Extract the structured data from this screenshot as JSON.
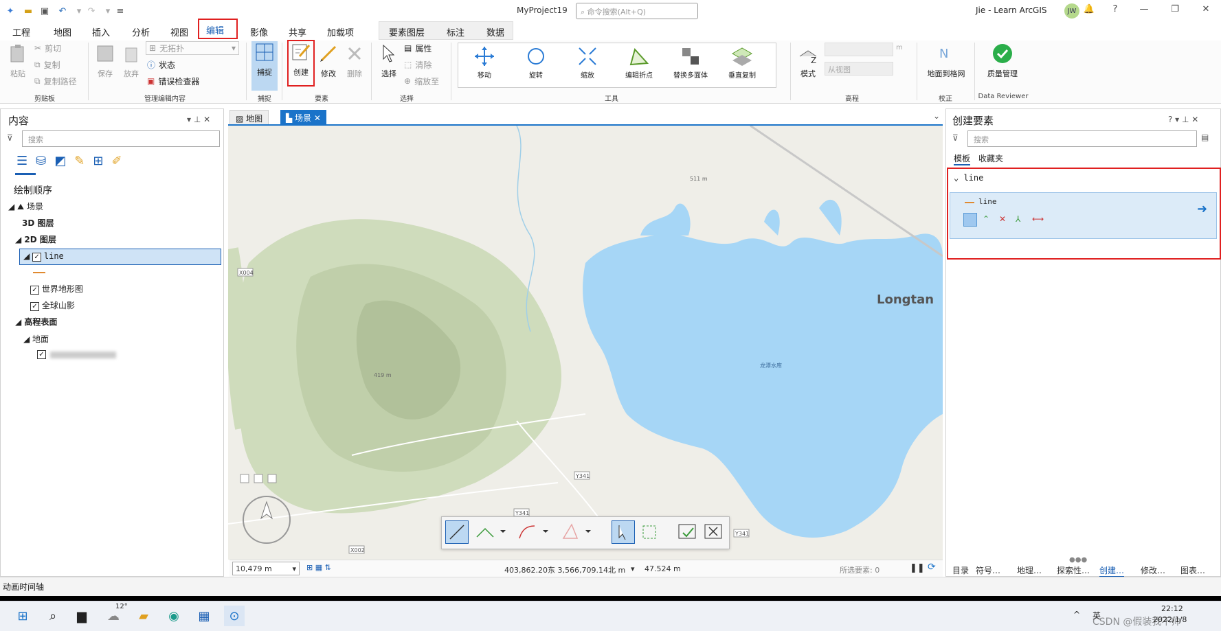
{
  "app": {
    "title": "MyProject19",
    "search_placeholder": "命令搜索(Alt+Q)",
    "user": "Jie - Learn ArcGIS",
    "avatar": "JW"
  },
  "tabs": [
    "工程",
    "地图",
    "插入",
    "分析",
    "视图",
    "编辑",
    "影像",
    "共享",
    "加载项"
  ],
  "context_tabs": [
    "要素图层",
    "标注",
    "数据"
  ],
  "ribbon": {
    "clipboard": {
      "paste": "粘贴",
      "cut": "剪切",
      "copy": "复制",
      "copy_path": "复制路径",
      "label": "剪贴板"
    },
    "manage": {
      "save": "保存",
      "discard": "放弃",
      "topology": "无拓扑",
      "status": "状态",
      "error_inspector": "错误检查器",
      "label": "管理编辑内容"
    },
    "snap": {
      "button": "捕捉",
      "label": "捕捉"
    },
    "features": {
      "create": "创建",
      "modify": "修改",
      "delete": "删除",
      "label": "要素"
    },
    "selection": {
      "select": "选择",
      "attributes": "属性",
      "clear": "清除",
      "zoom_to": "缩放至",
      "label": "选择"
    },
    "tools": {
      "items": [
        "移动",
        "旋转",
        "缩放",
        "编辑折点",
        "替换多面体",
        "垂直复制"
      ],
      "label": "工具"
    },
    "elevation": {
      "mode": "模式",
      "from_view": "从视图",
      "unit": "m",
      "label": "高程"
    },
    "correction": {
      "ground_to_grid": "地面到格网",
      "label": "校正"
    },
    "reviewer": {
      "quality": "质量管理",
      "label": "Data Reviewer"
    }
  },
  "contents": {
    "title": "内容",
    "search": "搜索",
    "draw_order": "绘制顺序",
    "scene": "场景",
    "layer3d": "3D 图层",
    "layer2d": "2D 图层",
    "line_layer": "line",
    "topo": "世界地形图",
    "hillshade": "全球山影",
    "elev_surface": "高程表面",
    "ground": "地面"
  },
  "map": {
    "tabs": [
      "地图",
      "场景"
    ],
    "labels": {
      "x004": "X004",
      "longtan": "Longtan",
      "reservoir": "龙潭水库",
      "y341a": "Y341",
      "y341b": "Y341",
      "y341c": "Y341",
      "x002": "X002",
      "peak1": "419 m",
      "peak2": "511 m"
    },
    "scale": "10,479 m",
    "coords": "403,862.20东 3,566,709.14北 m",
    "elev": "47.524 m",
    "selected": "所选要素: 0"
  },
  "create_features": {
    "title": "创建要素",
    "search": "搜索",
    "tab_templates": "模板",
    "tab_favorites": "收藏夹",
    "group": "line",
    "template": "line"
  },
  "bottom_tabs": [
    "目录",
    "符号…",
    "地理…",
    "探索性…",
    "创建…",
    "修改…",
    "图表…"
  ],
  "anim": "动画时间轴",
  "taskbar": {
    "weather": "12°",
    "lang": "英",
    "time": "22:12",
    "date": "2022/1/8"
  },
  "watermark": "CSDN @假装我不帅"
}
